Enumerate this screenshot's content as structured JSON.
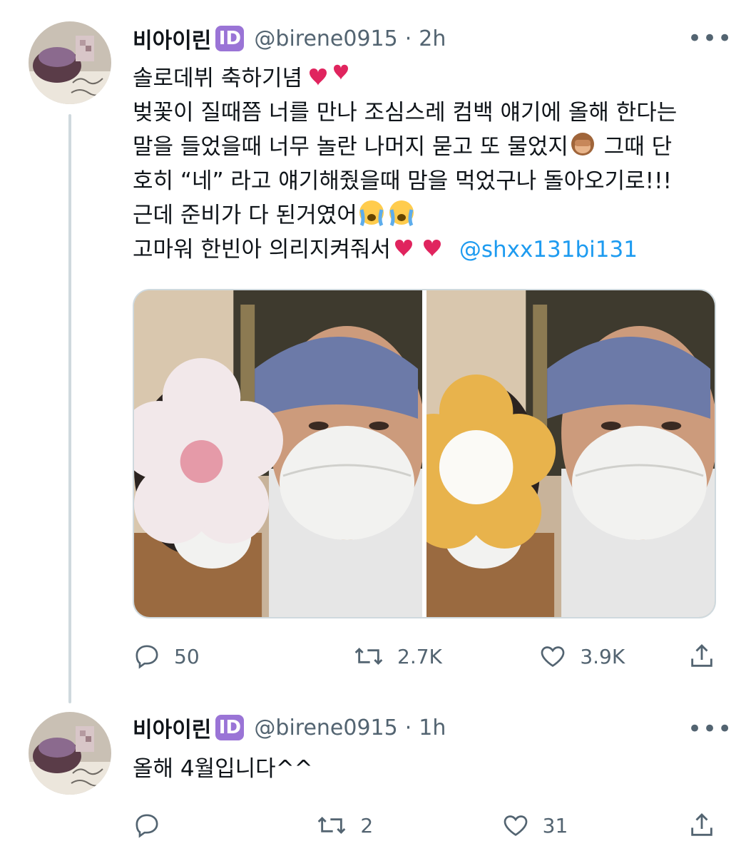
{
  "tweet1": {
    "display_name": "비아이린",
    "badge": "ID",
    "handle": "@birene0915",
    "time": "2h",
    "more_icon": "more-horizontal-icon",
    "lines": [
      "솔로데뷔 축하기념",
      "벚꽃이 질때쯤 너를 만나 조심스레 컴백 얘기에 올해 한다는",
      "말을 들었을때 너무 놀란 나머지 묻고 또 물었지",
      " 그때 단",
      "호히 “네” 라고 얘기해줬을때 맘을 먹었구나 돌아오기로!!!",
      "근데 준비가 다 된거였어",
      "고마워 한빈아 의리지켜줘서",
      "@shxx131bi131"
    ],
    "emoji": {
      "hearts": "two-hearts-emoji",
      "monkey": "see-no-evil-monkey-emoji",
      "crying": "loudly-crying-face-emoji"
    },
    "replies": "50",
    "retweets": "2.7K",
    "likes": "3.9K"
  },
  "tweet2": {
    "display_name": "비아이린",
    "badge": "ID",
    "handle": "@birene0915",
    "time": "1h",
    "text": "올해 4월입니다^^",
    "replies": "",
    "retweets": "2",
    "likes": "31"
  },
  "colors": {
    "text": "#0f1419",
    "secondary": "#536471",
    "link": "#1d9bf0",
    "badge": "#9a74d6",
    "thread_line": "#cfd9de"
  }
}
